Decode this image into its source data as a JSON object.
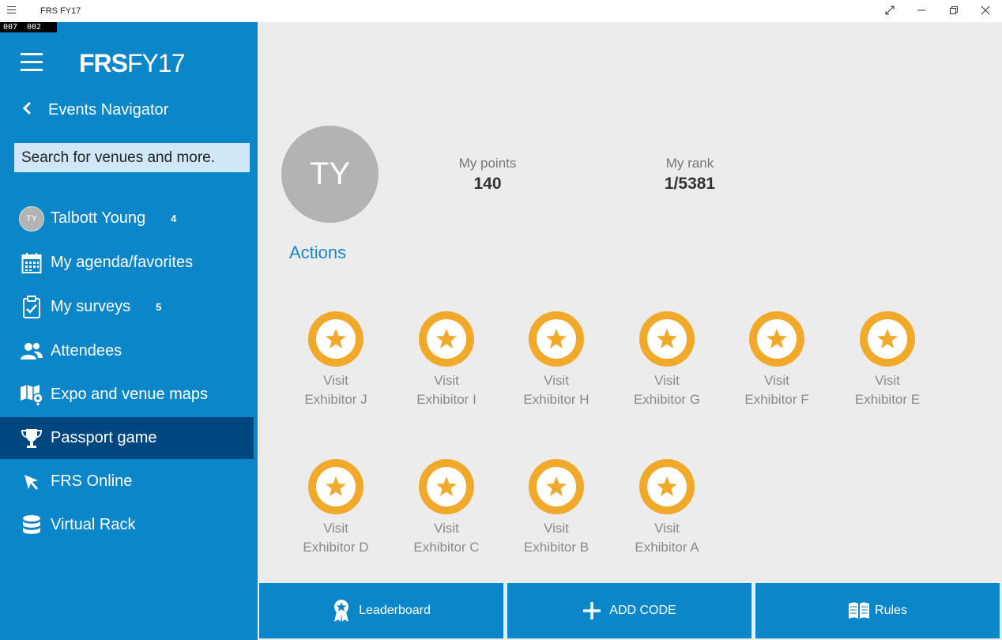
{
  "window": {
    "title": "FRS FY17",
    "fps_left": "007",
    "fps_right": "002"
  },
  "sidebar": {
    "brand_bold": "FRS",
    "brand_light": "FY17",
    "back_label": "Events Navigator",
    "search_placeholder": "Search for venues and more.",
    "items": [
      {
        "label": "Talbott Young",
        "badge": "4",
        "icon": "avatar",
        "avatar_initials": "TY"
      },
      {
        "label": "My agenda/favorites",
        "badge": "",
        "icon": "calendar-icon"
      },
      {
        "label": "My surveys",
        "badge": "5",
        "icon": "clipboard-icon"
      },
      {
        "label": "Attendees",
        "badge": "",
        "icon": "people-icon"
      },
      {
        "label": "Expo and venue maps",
        "badge": "",
        "icon": "map-icon"
      },
      {
        "label": "Passport game",
        "badge": "",
        "icon": "trophy-icon",
        "active": true
      },
      {
        "label": "FRS Online",
        "badge": "",
        "icon": "cursor-icon"
      },
      {
        "label": "Virtual Rack",
        "badge": "",
        "icon": "database-icon"
      }
    ]
  },
  "main": {
    "avatar_initials": "TY",
    "points_label": "My points",
    "points_value": "140",
    "rank_label": "My rank",
    "rank_value": "1/5381",
    "actions_title": "Actions",
    "actions": [
      {
        "line1": "Visit",
        "line2": "Exhibitor J"
      },
      {
        "line1": "Visit",
        "line2": "Exhibitor I"
      },
      {
        "line1": "Visit",
        "line2": "Exhibitor H"
      },
      {
        "line1": "Visit",
        "line2": "Exhibitor G"
      },
      {
        "line1": "Visit",
        "line2": "Exhibitor F"
      },
      {
        "line1": "Visit",
        "line2": "Exhibitor E"
      },
      {
        "line1": "Visit",
        "line2": "Exhibitor D"
      },
      {
        "line1": "Visit",
        "line2": "Exhibitor C"
      },
      {
        "line1": "Visit",
        "line2": "Exhibitor B"
      },
      {
        "line1": "Visit",
        "line2": "Exhibitor A"
      }
    ],
    "buttons": {
      "leaderboard": "Leaderboard",
      "add_code": "ADD CODE",
      "rules": "Rules"
    }
  },
  "colors": {
    "sidebar": "#0a86c9",
    "sidebar_active": "#00467f",
    "medal": "#f0a92b",
    "accent_text": "#1a86c5"
  }
}
